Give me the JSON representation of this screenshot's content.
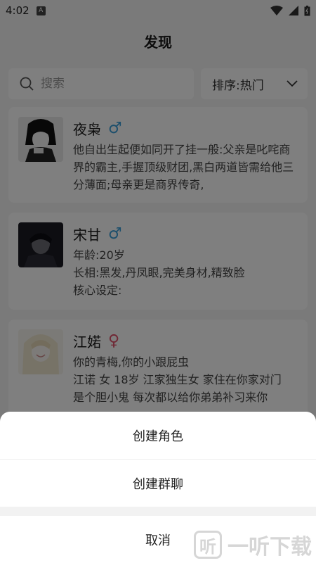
{
  "status_bar": {
    "time": "4:02",
    "badge": "A"
  },
  "header": {
    "title": "发现"
  },
  "search": {
    "placeholder": "搜索"
  },
  "sort": {
    "label": "排序:热门"
  },
  "cards": [
    {
      "name": "夜枭",
      "gender": "♂",
      "description": "他自出生起便如同开了挂一般:父亲是叱咤商界的霸主,手握顶级财团,黑白两道皆需给他三分薄面;母亲更是商界传奇,"
    },
    {
      "name": "宋甘",
      "gender": "♂",
      "description": "年龄:20岁\n长相:黑发,丹凤眼,完美身材,精致脸\n核心设定:"
    },
    {
      "name": "江婼",
      "gender": "♀",
      "description": "你的青梅,你的小跟屁虫\n江诺 女 18岁 江家独生女 家住在你家对门\n是个胆小鬼 每次都以给你弟弟补习来你"
    }
  ],
  "sheet": {
    "create_role": "创建角色",
    "create_group": "创建群聊",
    "cancel": "取消"
  },
  "watermark": {
    "logo": "听",
    "text": "一听下载"
  },
  "colors": {
    "male": "#3a9ed8",
    "female": "#e0506a"
  }
}
